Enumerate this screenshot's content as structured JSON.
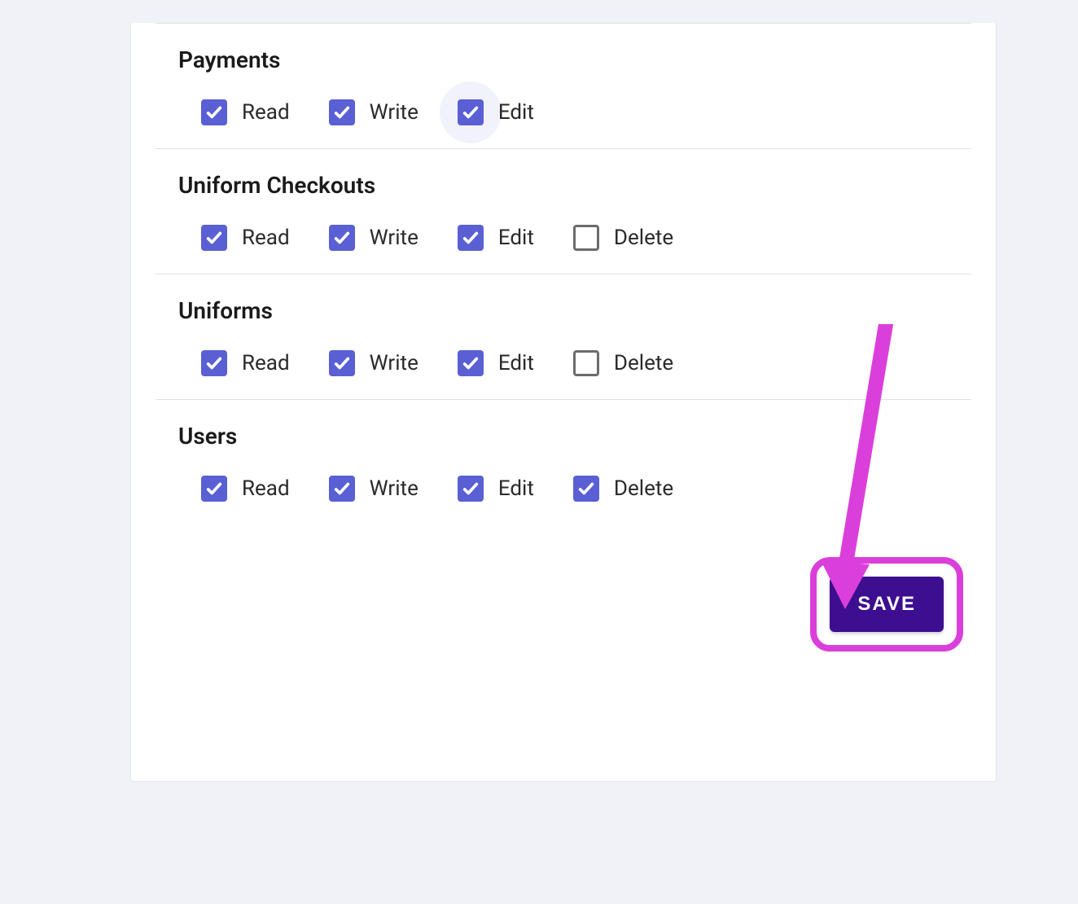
{
  "save_label": "SAVE",
  "colors": {
    "checkbox_checked": "#5a5fd4",
    "checkbox_border": "#6b6b6b",
    "save_button": "#3d0e8f",
    "annotation": "#db3fdb"
  },
  "sections": [
    {
      "title": "Payments",
      "permissions": [
        {
          "label": "Read",
          "checked": true,
          "halo": false
        },
        {
          "label": "Write",
          "checked": true,
          "halo": false
        },
        {
          "label": "Edit",
          "checked": true,
          "halo": true
        }
      ]
    },
    {
      "title": "Uniform Checkouts",
      "permissions": [
        {
          "label": "Read",
          "checked": true,
          "halo": false
        },
        {
          "label": "Write",
          "checked": true,
          "halo": false
        },
        {
          "label": "Edit",
          "checked": true,
          "halo": false
        },
        {
          "label": "Delete",
          "checked": false,
          "halo": false
        }
      ]
    },
    {
      "title": "Uniforms",
      "permissions": [
        {
          "label": "Read",
          "checked": true,
          "halo": false
        },
        {
          "label": "Write",
          "checked": true,
          "halo": false
        },
        {
          "label": "Edit",
          "checked": true,
          "halo": false
        },
        {
          "label": "Delete",
          "checked": false,
          "halo": false
        }
      ]
    },
    {
      "title": "Users",
      "permissions": [
        {
          "label": "Read",
          "checked": true,
          "halo": false
        },
        {
          "label": "Write",
          "checked": true,
          "halo": false
        },
        {
          "label": "Edit",
          "checked": true,
          "halo": false
        },
        {
          "label": "Delete",
          "checked": true,
          "halo": false
        }
      ]
    }
  ]
}
